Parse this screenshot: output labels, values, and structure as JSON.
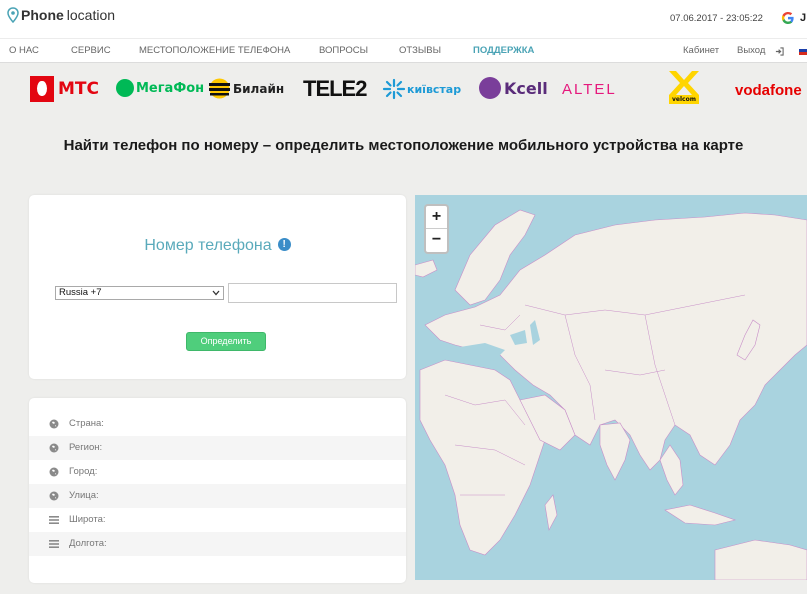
{
  "header": {
    "logo_bold": "Phone",
    "logo_light": "location",
    "datetime": "07.06.2017 - 23:05:22",
    "user_initial": "J"
  },
  "nav": {
    "items": [
      "О НАС",
      "СЕРВИС",
      "МЕСТОПОЛОЖЕНИЕ ТЕЛЕФОНА",
      "ВОПРОСЫ",
      "ОТЗЫВЫ",
      "ПОДДЕРЖКА"
    ],
    "active_index": 5,
    "cabinet": "Кабинет",
    "exit": "Выход"
  },
  "operators": {
    "mts": "МТС",
    "megafon": "МегаФон",
    "beeline": "Билайн",
    "tele2": "TELE2",
    "kyivstar": "київстар",
    "kcell": "Kcell",
    "altel": "ALTEL",
    "velcom": "velcom",
    "vodafone": "vodafone"
  },
  "headline": "Найти телефон по номеру – определить местоположение мобильного устройства на карте",
  "form": {
    "title": "Номер телефона",
    "info_glyph": "!",
    "country_selected": "Russia +7",
    "phone_value": "",
    "submit_label": "Определить"
  },
  "details": {
    "rows": [
      {
        "label": "Страна:",
        "icon": "globe-icon"
      },
      {
        "label": "Регион:",
        "icon": "globe-icon"
      },
      {
        "label": "Город:",
        "icon": "globe-icon"
      },
      {
        "label": "Улица:",
        "icon": "globe-icon"
      },
      {
        "label": "Широта:",
        "icon": "grid-icon"
      },
      {
        "label": "Долгота:",
        "icon": "grid-icon"
      }
    ]
  },
  "map": {
    "zoom_in": "+",
    "zoom_out": "−"
  },
  "colors": {
    "accent": "#4aa3b5",
    "button": "#4fce7c",
    "ocean": "#a9d3df",
    "land": "#f2efe9",
    "border": "#c88ec8"
  }
}
